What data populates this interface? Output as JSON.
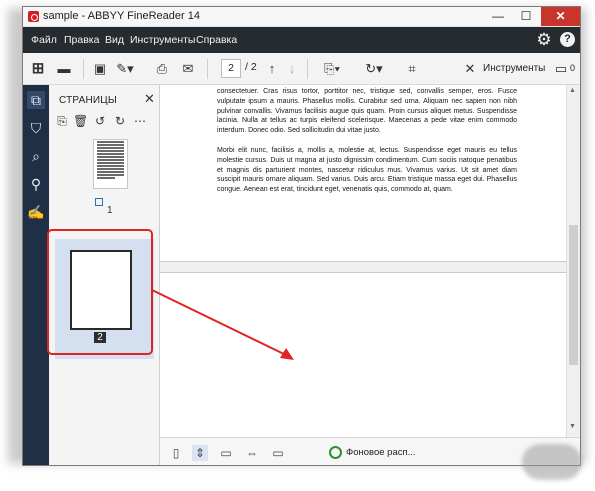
{
  "window": {
    "title": "sample - ABBYY FineReader 14",
    "controls": {
      "minimize": "—",
      "maximize": "☐",
      "close": "✕"
    }
  },
  "menu": {
    "items": [
      "Файл",
      "Правка",
      "Вид",
      "Инструменты",
      "Справка"
    ],
    "icons": [
      "gear-icon",
      "help-icon"
    ]
  },
  "toolbar": {
    "current_page": "2",
    "total_pages": "/ 2",
    "tools_label": "Инструменты",
    "comments_count": "0"
  },
  "pages_panel": {
    "title": "СТРАНИЦЫ",
    "close": "✕",
    "thumbnails": [
      {
        "number": "1"
      },
      {
        "number": "2",
        "selected": true
      }
    ]
  },
  "document": {
    "paragraphs": [
      "consectetuer. Cras risus tortor, porttitor nec, tristique sed, convallis semper, eros. Fusce vulputate ipsum a mauris. Phasellus mollis. Curabitur sed urna. Aliquam nec sapien non nibh pulvinar convallis. Vivamus facilisis augue quis quam. Proin cursus aliquet metus. Suspendisse lacinia. Nulla at tellus ac turpis eleifend scelerisque. Maecenas a pede vitae enim commodo interdum. Donec odio. Sed sollicitudin dui vitae justo.",
      "Morbi elit nunc, facilisis a, mollis a, molestie at, lectus. Suspendisse eget mauris eu tellus molestie cursus. Duis ut magna at justo dignissim condimentum. Cum sociis natoque penatibus et magnis dis parturient montes, nascetur ridiculus mus. Vivamus varius. Ut sit amet diam suscipit mauris ornare aliquam. Sed varius. Duis arcu. Etiam tristique massa eget dui. Phasellus congue. Aenean est erat, tincidunt eget, venenatis quis, commodo at, quam."
    ]
  },
  "statusbar": {
    "background_text": "Фоновое расп..."
  },
  "colors": {
    "menubar": "#262b30",
    "leftrail": "#1f2f45",
    "close_button": "#c8362b",
    "annotation": "#e02424",
    "selection": "#d4dff0"
  }
}
